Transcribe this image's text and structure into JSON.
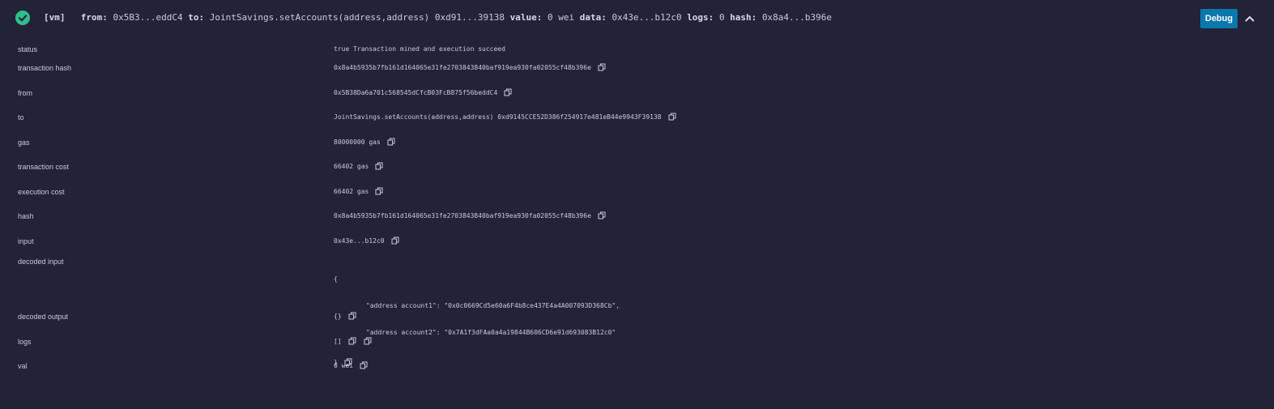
{
  "summary": {
    "network": "[vm]",
    "from_label": "from:",
    "from_value": "0x5B3...eddC4",
    "to_label": "to:",
    "to_value": "JointSavings.setAccounts(address,address) 0xd91...39138",
    "value_label": "value:",
    "value_value": "0 wei",
    "data_label": "data:",
    "data_value": "0x43e...b12c0",
    "logs_label": "logs:",
    "logs_value": "0",
    "hash_label": "hash:",
    "hash_value": "0x8a4...b396e",
    "debug_label": "Debug"
  },
  "rows": {
    "status": {
      "label": "status",
      "value": "true Transaction mined and execution succeed"
    },
    "transaction_hash": {
      "label": "transaction hash",
      "value": "0x8a4b5935b7fb161d164065e31fe2703843840baf919ea930fa02055cf48b396e"
    },
    "from": {
      "label": "from",
      "value": "0x5B38Da6a701c568545dCfcB03FcB875f56beddC4"
    },
    "to": {
      "label": "to",
      "value": "JointSavings.setAccounts(address,address) 0xd9145CCE52D386f254917e481eB44e9943F39138"
    },
    "gas": {
      "label": "gas",
      "value": "80000000 gas"
    },
    "transaction_cost": {
      "label": "transaction cost",
      "value": "66402 gas"
    },
    "execution_cost": {
      "label": "execution cost",
      "value": "66402 gas"
    },
    "hash": {
      "label": "hash",
      "value": "0x8a4b5935b7fb161d164065e31fe2703843840baf919ea930fa02055cf48b396e"
    },
    "input": {
      "label": "input",
      "value": "0x43e...b12c0"
    },
    "decoded_input": {
      "label": "decoded input",
      "open": "{",
      "line1": "\"address account1\": \"0x0c0669Cd5e60a6F4b8ce437E4a4A007093D368Cb\",",
      "line2": "\"address account2\": \"0x7A1f3dFAa0a4a19844B606CD6e91d693083B12c0\"",
      "close": "}"
    },
    "decoded_output": {
      "label": "decoded output",
      "value": "{}"
    },
    "logs": {
      "label": "logs",
      "value": "[]"
    },
    "val": {
      "label": "val",
      "value": "0 wei"
    }
  },
  "colors": {
    "background": "#222336",
    "success": "#2fbf8b",
    "debug_button": "#0a77ad",
    "text": "#c9cbdc"
  },
  "icons": {
    "status": "check-circle-icon",
    "copy": "copy-icon",
    "collapse": "chevron-up-icon"
  }
}
